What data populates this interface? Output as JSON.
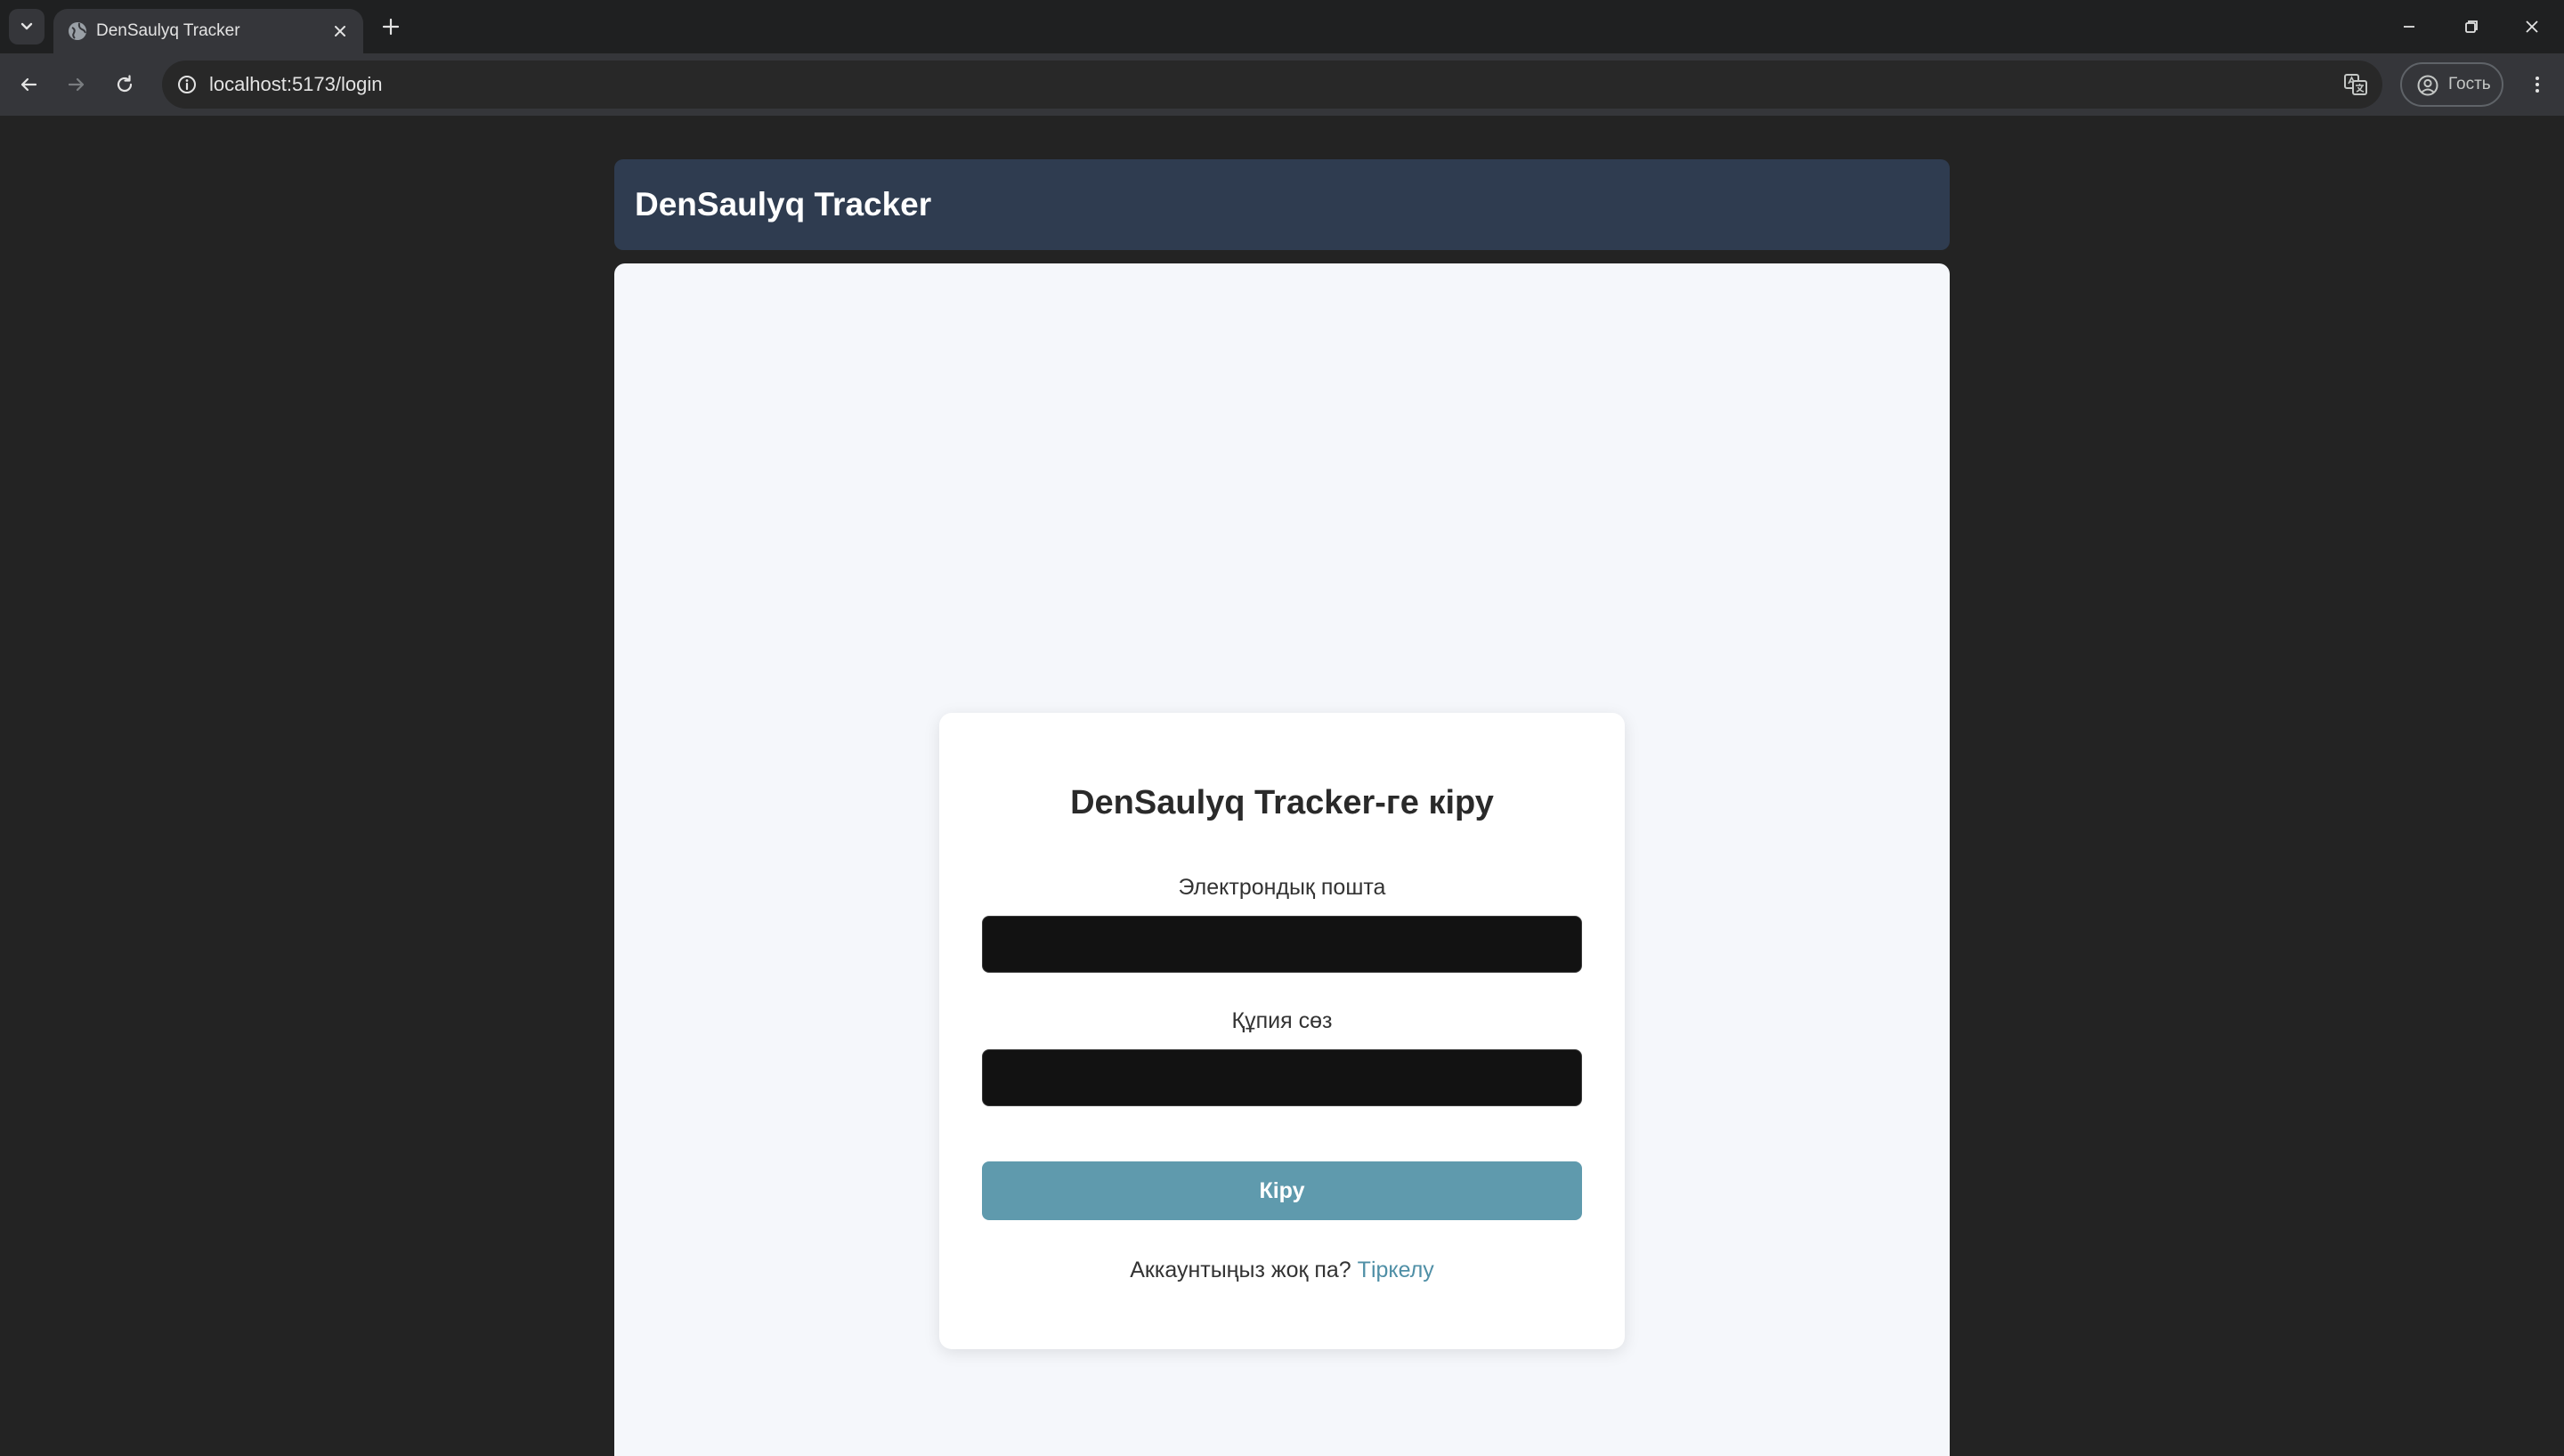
{
  "browser": {
    "tab_title": "DenSaulyq Tracker",
    "url": "localhost:5173/login",
    "profile_label": "Гость"
  },
  "app": {
    "logo": "DenSaulyq Tracker"
  },
  "login": {
    "title": "DenSaulyq Tracker-ге кіру",
    "email_label": "Электрондық пошта",
    "email_value": "",
    "password_label": "Құпия сөз",
    "password_value": "",
    "submit_label": "Кіру",
    "no_account_text": "Аккаунтыңыз жоқ па?",
    "register_link": "Тіркелу"
  },
  "colors": {
    "header_bg": "#2f3c50",
    "button_bg": "#5f9aad",
    "link": "#4f8fa6",
    "content_bg": "#f5f7fb"
  },
  "icons": {
    "tab_menu": "chevron-down-icon",
    "favicon": "globe-icon",
    "tab_close": "close-icon",
    "new_tab": "plus-icon",
    "minimize": "minimize-icon",
    "restore": "restore-icon",
    "close_window": "close-icon",
    "back": "arrow-left-icon",
    "forward": "arrow-right-icon",
    "reload": "reload-icon",
    "site_info": "info-icon",
    "translate": "translate-icon",
    "profile": "person-icon",
    "menu": "kebab-icon"
  }
}
